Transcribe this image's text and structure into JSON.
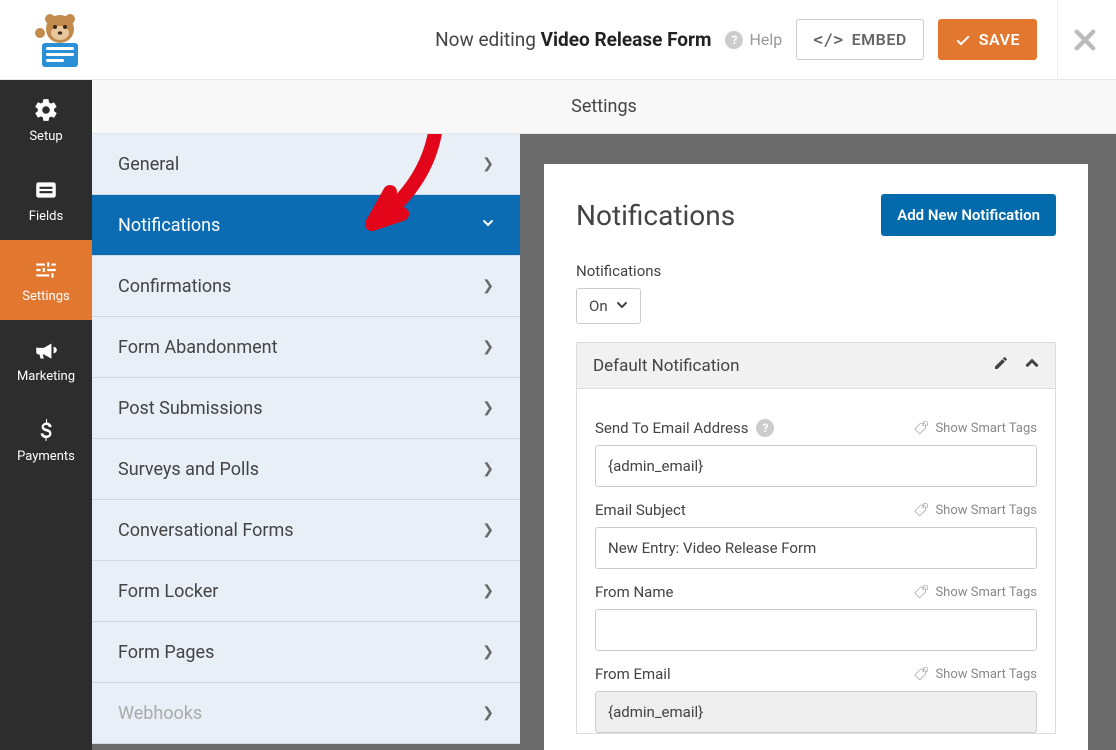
{
  "topbar": {
    "editing_prefix": "Now editing",
    "form_name": "Video Release Form",
    "help_label": "Help",
    "embed_label": "EMBED",
    "save_label": "SAVE"
  },
  "rail": {
    "items": [
      {
        "label": "Setup"
      },
      {
        "label": "Fields"
      },
      {
        "label": "Settings"
      },
      {
        "label": "Marketing"
      },
      {
        "label": "Payments"
      }
    ]
  },
  "settings": {
    "header": "Settings",
    "items": [
      {
        "label": "General"
      },
      {
        "label": "Notifications"
      },
      {
        "label": "Confirmations"
      },
      {
        "label": "Form Abandonment"
      },
      {
        "label": "Post Submissions"
      },
      {
        "label": "Surveys and Polls"
      },
      {
        "label": "Conversational Forms"
      },
      {
        "label": "Form Locker"
      },
      {
        "label": "Form Pages"
      },
      {
        "label": "Webhooks"
      }
    ]
  },
  "panel": {
    "title": "Notifications",
    "add_button": "Add New Notification",
    "toggle_label": "Notifications",
    "toggle_value": "On",
    "subpanel_title": "Default Notification",
    "smart_tags_label": "Show Smart Tags",
    "fields": {
      "send_to_label": "Send To Email Address",
      "send_to_value": "{admin_email}",
      "subject_label": "Email Subject",
      "subject_value": "New Entry: Video Release Form",
      "from_name_label": "From Name",
      "from_name_value": "",
      "from_email_label": "From Email",
      "from_email_value": "{admin_email}"
    }
  }
}
